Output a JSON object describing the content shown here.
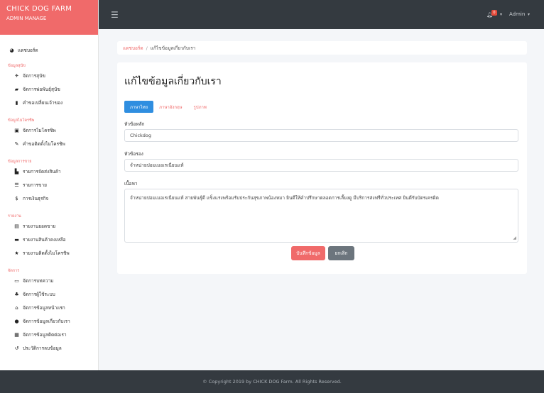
{
  "brand": {
    "title": "CHICK DOG FARM",
    "subtitle": "ADMIN MANAGE"
  },
  "colors": {
    "accent": "#f06a6a",
    "topbar": "#343a40",
    "tab_active": "#2f8ee0",
    "cancel": "#6c757d"
  },
  "sidebar": {
    "dashboard": {
      "label": "แดชบอร์ด",
      "icon": "dashboard-icon"
    },
    "sections": [
      {
        "title": "ข้อมูลสุนัข",
        "items": [
          {
            "label": "จัดการสุนัข",
            "icon": "paw-icon"
          },
          {
            "label": "จัดการพ่อพันธุ์สุนัข",
            "icon": "car-icon"
          },
          {
            "label": "คำขอเปลี่ยนเจ้าของ",
            "icon": "bookmark-icon"
          }
        ]
      },
      {
        "title": "ข้อมูลไมโครชิพ",
        "items": [
          {
            "label": "จัดการไมโครชิพ",
            "icon": "chip-icon"
          },
          {
            "label": "คำขอติดตั้งไมโครชิพ",
            "icon": "pen-icon"
          }
        ]
      },
      {
        "title": "ข้อมูลการขาย",
        "items": [
          {
            "label": "รายการจัดส่งสินค้า",
            "icon": "truck-icon"
          },
          {
            "label": "รายการขาย",
            "icon": "receipt-icon"
          },
          {
            "label": "การเงินธุรกิจ",
            "icon": "dollar-icon"
          }
        ]
      },
      {
        "title": "รายงาน",
        "items": [
          {
            "label": "รายงานยอดขาย",
            "icon": "document-icon"
          },
          {
            "label": "รายงานสินค้าคงเหลือ",
            "icon": "archive-icon"
          },
          {
            "label": "รายงานติดตั้งไมโครชิพ",
            "icon": "star-icon"
          }
        ]
      },
      {
        "title": "จัดการ",
        "items": [
          {
            "label": "จัดการบทความ",
            "icon": "article-icon"
          },
          {
            "label": "จัดการผู้ใช้ระบบ",
            "icon": "users-icon"
          },
          {
            "label": "จัดการข้อมูลหน้าแรก",
            "icon": "home-icon"
          },
          {
            "label": "จัดการข้อมูลเกี่ยวกับเรา",
            "icon": "info-icon"
          },
          {
            "label": "จัดการข้อมูลติดต่อเรา",
            "icon": "contact-card-icon"
          },
          {
            "label": "ประวัติการลบข้อมูล",
            "icon": "history-icon"
          }
        ]
      }
    ]
  },
  "topbar": {
    "menu_icon": "hamburger-icon",
    "notification_count": "0",
    "user_label": "Admin"
  },
  "breadcrumb": {
    "home": "แดชบอร์ด",
    "separator": "/",
    "current": "แก้ไขข้อมูลเกี่ยวกับเรา"
  },
  "page": {
    "title": "แก้ไขข้อมูลเกี่ยวกับเรา",
    "tabs": [
      {
        "label": "ภาษาไทย",
        "active": true
      },
      {
        "label": "ภาษาอังกฤษ",
        "active": false
      },
      {
        "label": "รูปภาพ",
        "active": false
      }
    ],
    "fields": {
      "heading_label": "หัวข้อหลัก",
      "heading_value": "Chickdog",
      "subheading_label": "หัวข้อรอง",
      "subheading_value": "จำหน่ายปอมเมอเรเนียนแท้",
      "content_label": "เนื้อหา",
      "content_value": "จำหน่ายปอมเมอเรเนียนแท้ สายพันธุ์ดี แข็งแรงพร้อมรับประกันสุขภาพน้องหมา ยินดีให้คำปรึกษาตลอดการเลี้ยงดู มีบริการส่งฟรีทั่วประเทศ ยินดีรับบัตรเครดิต"
    },
    "buttons": {
      "save": "บันทึกข้อมูล",
      "cancel": "ยกเลิก"
    }
  },
  "footer": {
    "text": "© Copyright 2019 by CHICK DOG Farm. All Rights Reserved."
  }
}
